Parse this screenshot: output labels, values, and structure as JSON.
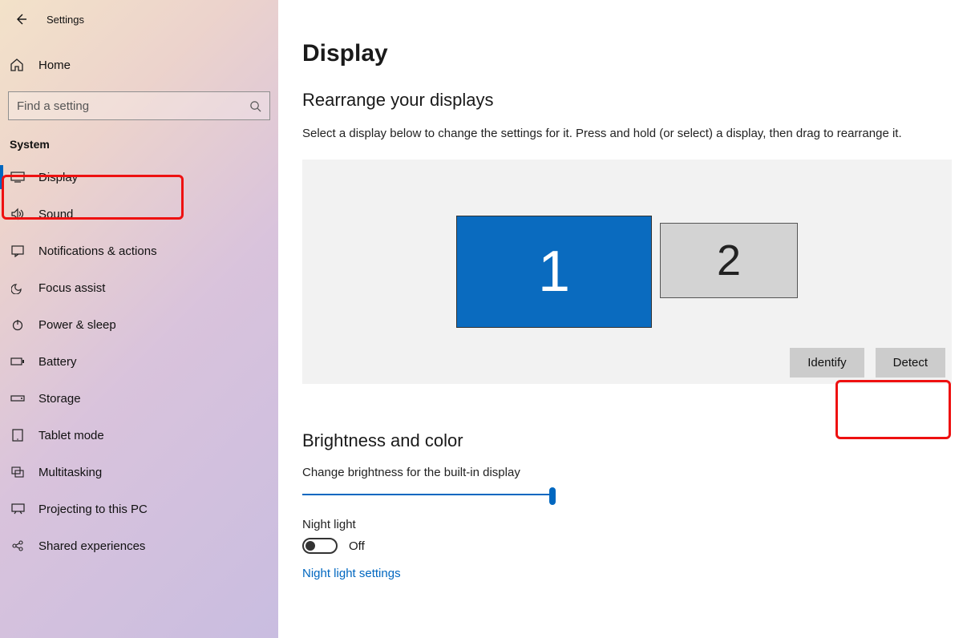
{
  "window": {
    "title": "Settings"
  },
  "sidebar": {
    "home": "Home",
    "search_placeholder": "Find a setting",
    "category": "System",
    "items": [
      {
        "label": "Display"
      },
      {
        "label": "Sound"
      },
      {
        "label": "Notifications & actions"
      },
      {
        "label": "Focus assist"
      },
      {
        "label": "Power & sleep"
      },
      {
        "label": "Battery"
      },
      {
        "label": "Storage"
      },
      {
        "label": "Tablet mode"
      },
      {
        "label": "Multitasking"
      },
      {
        "label": "Projecting to this PC"
      },
      {
        "label": "Shared experiences"
      }
    ]
  },
  "main": {
    "title": "Display",
    "rearrange": {
      "heading": "Rearrange your displays",
      "helper": "Select a display below to change the settings for it. Press and hold (or select) a display, then drag to rearrange it.",
      "monitors": {
        "primary": "1",
        "secondary": "2"
      },
      "identify": "Identify",
      "detect": "Detect"
    },
    "brightness": {
      "heading": "Brightness and color",
      "slider_label": "Change brightness for the built-in display",
      "nightlight_label": "Night light",
      "nightlight_state": "Off",
      "nightlight_link": "Night light settings"
    }
  }
}
